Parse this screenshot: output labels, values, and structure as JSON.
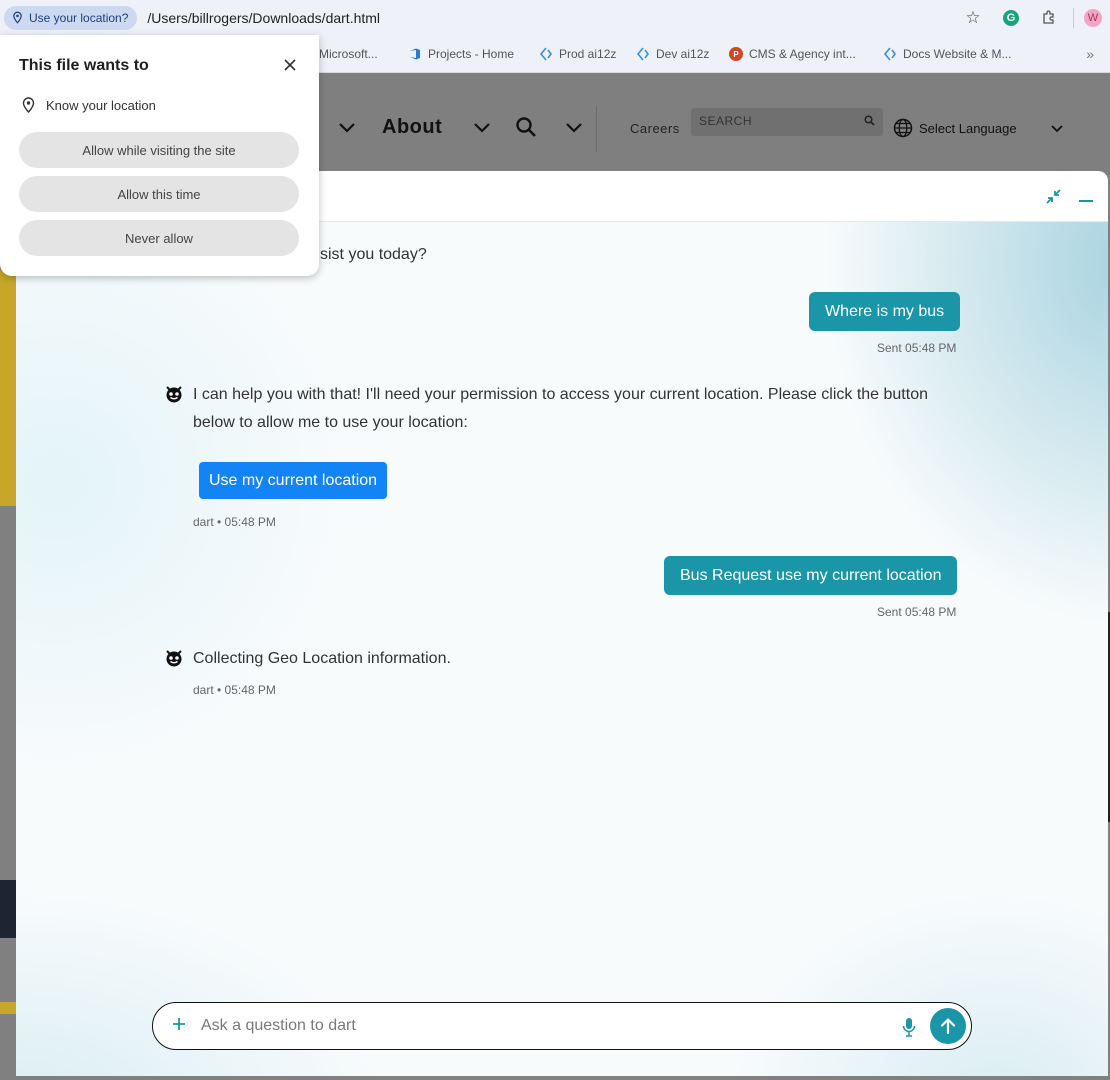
{
  "browser": {
    "location_pill": "Use your location?",
    "url": "/Users/billrogers/Downloads/dart.html",
    "profile_initial": "W",
    "bookmarks": [
      {
        "label": "Microsoft..."
      },
      {
        "label": "Projects - Home"
      },
      {
        "label": "Prod ai12z"
      },
      {
        "label": "Dev ai12z"
      },
      {
        "label": "CMS & Agency int..."
      },
      {
        "label": "Docs Website & M..."
      }
    ]
  },
  "permission_popup": {
    "title": "This file wants to",
    "request": "Know your location",
    "buttons": {
      "allow_visit": "Allow while visiting the site",
      "allow_once": "Allow this time",
      "never": "Never allow"
    }
  },
  "site": {
    "nav_about": "About",
    "careers": "Careers",
    "search_placeholder": "SEARCH",
    "select_language": "Select Language"
  },
  "chat": {
    "partial_greeting": "sist you today?",
    "messages": [
      {
        "role": "user",
        "text": "Where is my bus",
        "meta": "Sent 05:48 PM"
      },
      {
        "role": "bot",
        "text": "I can help you with that! I'll need your permission to access your current location. Please click the button below to allow me to use your location:",
        "button": "Use my current location",
        "meta": "dart • 05:48 PM"
      },
      {
        "role": "user",
        "text": "Bus Request use my current location",
        "meta": "Sent 05:48 PM"
      },
      {
        "role": "bot",
        "text": "Collecting Geo Location information.",
        "meta": "dart • 05:48 PM"
      }
    ],
    "composer": {
      "placeholder": "Ask a question to dart"
    },
    "accent_color": "#1b95a8",
    "button_color": "#1284f5"
  },
  "icons": [
    "location-pin-icon",
    "star-icon",
    "grammarly-icon",
    "extensions-icon",
    "close-icon",
    "collapse-icon",
    "minimize-icon",
    "bot-avatar-icon",
    "plus-icon",
    "microphone-icon",
    "send-arrow-icon",
    "globe-icon",
    "search-icon",
    "chevron-down-icon"
  ]
}
